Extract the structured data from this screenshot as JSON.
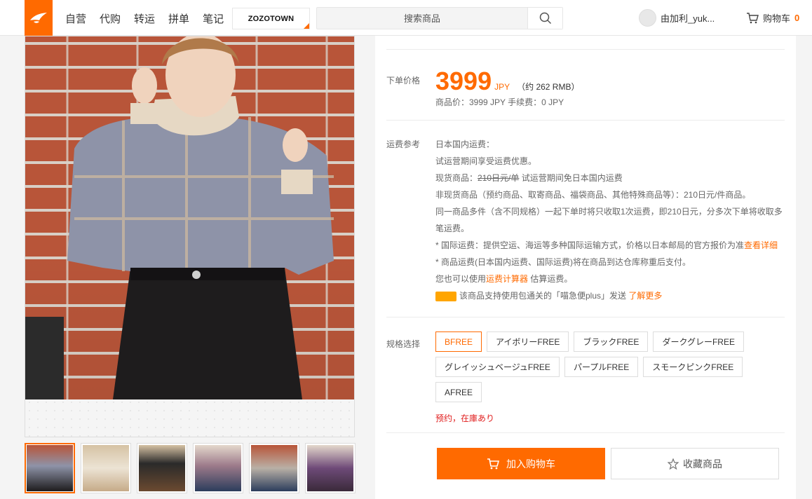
{
  "nav": {
    "items": [
      "自营",
      "代购",
      "转运",
      "拼单",
      "笔记"
    ]
  },
  "partner": {
    "name": "ZOZOTOWN"
  },
  "search": {
    "placeholder": "搜索商品"
  },
  "user": {
    "name": "由加利_yuk..."
  },
  "cart": {
    "label": "购物车",
    "count": "0"
  },
  "product": {
    "order_price_label": "下单价格",
    "price": "3999",
    "currency": "JPY",
    "rmb_approx": "（约 262 RMB）",
    "breakdown": "商品价：3999 JPY    手续费：0 JPY",
    "shipping_label": "运费参考",
    "shipping_lines": {
      "l1": "日本国内运费：",
      "l2": "试运营期间享受运费优惠。",
      "l3_a": "现货商品：",
      "l3_strike": "210日元/单",
      "l3_b": " 试运营期间免日本国内运费",
      "l4": "非现货商品（预约商品、取寄商品、福袋商品、其他特殊商品等）：210日元/件商品。",
      "l5": "同一商品多件（含不同规格）一起下单时将只收取1次运费，即210日元，分多次下单将收取多",
      "l6": "笔运费。",
      "l7_a": "* 国际运费：提供空运、海运等多种国际运输方式，价格以日本邮局的官方报价为准",
      "l7_link": "查看详细",
      "l8": "* 商品运费(日本国内运费、国际运费)将在商品到达仓库称重后支付。",
      "l9_a": "您也可以使用",
      "l9_link": "运费计算器",
      "l9_b": " 估算运费。",
      "l10_a": "该商品支持使用包通关的「喵急便plus」发送 ",
      "l10_link": "了解更多"
    },
    "spec_label": "规格选择",
    "specs": [
      "BFREE",
      "アイボリーFREE",
      "ブラックFREE",
      "ダークグレーFREE",
      "グレイッシュベージュFREE",
      "パープルFREE",
      "スモークピンクFREE",
      "AFREE"
    ],
    "stock_status": "预约，在庫あり",
    "add_to_cart": "加入购物车",
    "favorite": "收藏商品"
  },
  "colors": {
    "accent": "#ff6a00",
    "stock": "#e01d1d"
  },
  "thumbnails": [
    "#c98a7a",
    "#e6d8c4",
    "#2a2a2a",
    "#9c7a8a",
    "#b9b0a6",
    "#6e4a78"
  ]
}
